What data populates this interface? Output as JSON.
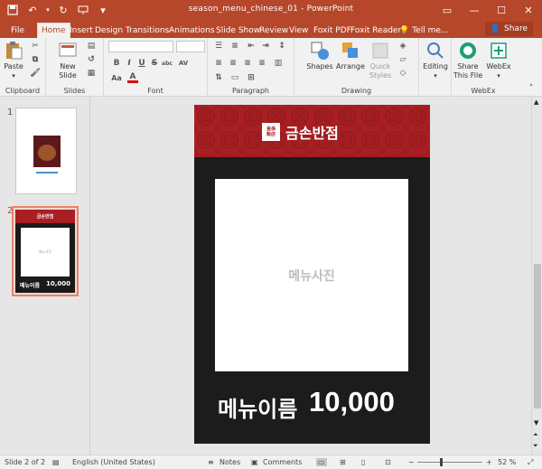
{
  "titlebar": {
    "title": "season_menu_chinese_01 - PowerPoint",
    "qat_icons": [
      "save-icon",
      "undo-icon",
      "redo-icon",
      "present-icon",
      "customize-icon"
    ],
    "window_controls": [
      "minimize-icon",
      "restore-icon",
      "close-icon"
    ]
  },
  "tabs": [
    "File",
    "Home",
    "Insert",
    "Design",
    "Transitions",
    "Animations",
    "Slide Show",
    "Review",
    "View",
    "Foxit PDF",
    "Foxit Reader",
    "Tell me..."
  ],
  "active_tab": "Home",
  "share_label": "Share",
  "ribbon": {
    "clipboard": {
      "paste": "Paste",
      "label": "Clipboard"
    },
    "slides": {
      "new_slide": "New\nSlide",
      "label": "Slides"
    },
    "font": {
      "label": "Font",
      "buttons": [
        "B",
        "I",
        "U",
        "S",
        "abc",
        "AV",
        "Aa",
        "A"
      ]
    },
    "paragraph": {
      "label": "Paragraph"
    },
    "drawing": {
      "shapes": "Shapes",
      "arrange": "Arrange",
      "quick_styles": "Quick\nStyles",
      "label": "Drawing"
    },
    "editing": {
      "label": "Editing"
    },
    "webex": {
      "share_file": "Share\nThis File",
      "webex": "WebEx",
      "label": "WebEx"
    }
  },
  "slides_panel": {
    "slide1_number": "1",
    "slide2_number": "2",
    "thumb2_title": "금손반점",
    "thumb2_photo": "메뉴사진",
    "thumb2_name": "메뉴이름",
    "thumb2_price": "10,000"
  },
  "slide": {
    "brand_name": "금손반점",
    "seal_text": "金孫飯店",
    "photo_placeholder": "메뉴사진",
    "menu_name": "메뉴이름",
    "price": "10,000",
    "colors": {
      "header_red": "#a81e22",
      "background": "#1c1c1c",
      "photo_bg": "#ffffff"
    }
  },
  "statusbar": {
    "slide_info": "Slide 2 of 2",
    "language": "English (United States)",
    "notes": "Notes",
    "comments": "Comments",
    "zoom": "52 %"
  },
  "colors": {
    "accent": "#b7472a",
    "ribbon_bg": "#f1f1f1"
  }
}
